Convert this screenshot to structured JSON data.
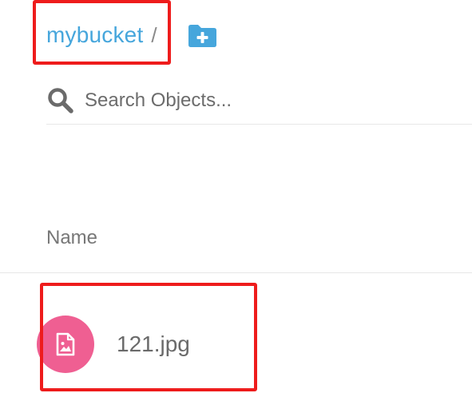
{
  "breadcrumb": {
    "bucket": "mybucket",
    "separator": "/"
  },
  "new_folder_button": {
    "icon": "folder-plus-icon",
    "color": "#46a6dc"
  },
  "search": {
    "placeholder": "Search Objects..."
  },
  "table": {
    "columns": [
      "Name"
    ],
    "rows": [
      {
        "name": "121.jpg",
        "icon": "image-file-icon",
        "icon_color": "#ef5f92"
      }
    ]
  },
  "colors": {
    "link": "#46a6dc",
    "annotation": "#ee1c1c"
  }
}
